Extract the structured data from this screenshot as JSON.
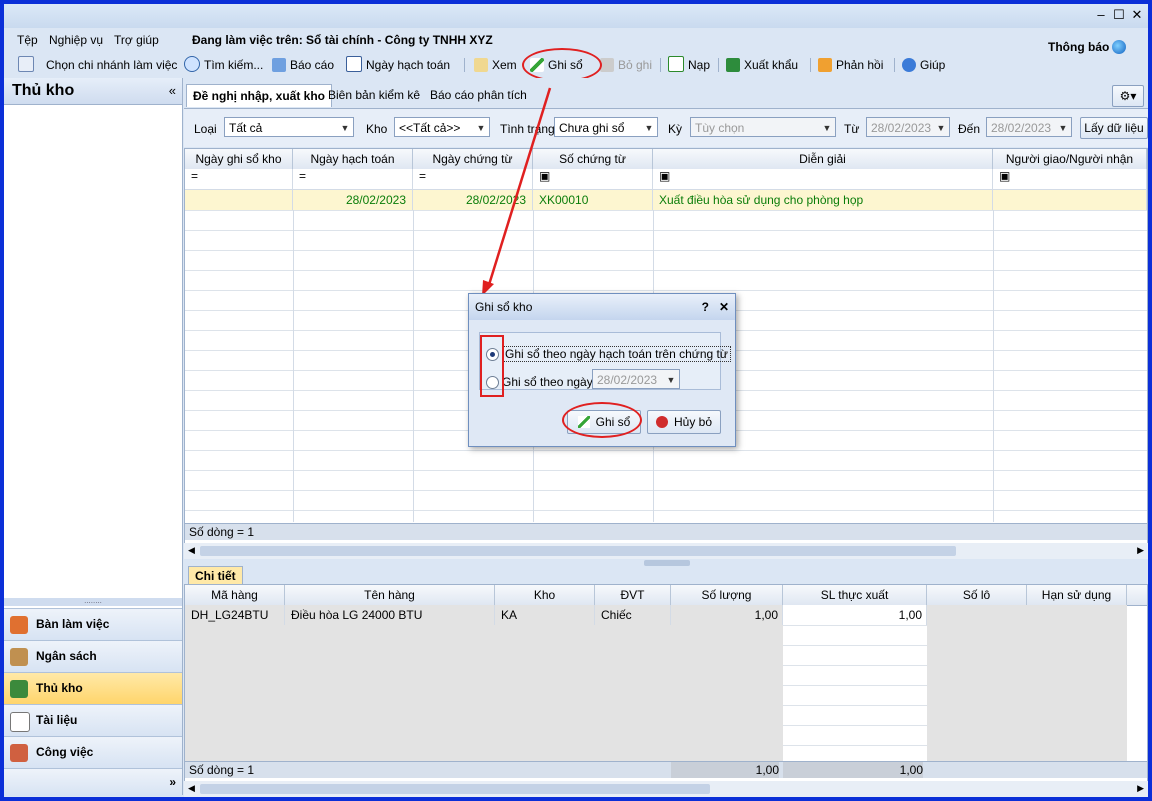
{
  "window": {
    "controls": [
      "‒",
      "☐",
      "✕"
    ]
  },
  "menu": {
    "items": [
      "Tệp",
      "Nghiệp vụ",
      "Trợ giúp"
    ],
    "working_on": "Đang làm việc trên: Sổ tài chính - Công ty TNHH XYZ",
    "notify": "Thông báo"
  },
  "toolbar": {
    "branch": "Chọn chi nhánh làm việc",
    "search": "Tìm kiếm...",
    "report": "Báo cáo",
    "posting_date": "Ngày hạch toán",
    "view": "Xem",
    "post": "Ghi sổ",
    "unpost": "Bỏ ghi",
    "load": "Nạp",
    "export": "Xuất khẩu",
    "feedback": "Phản hồi",
    "help": "Giúp"
  },
  "left": {
    "title": "Thủ kho",
    "collapse": "«",
    "grip": "........",
    "nav": [
      "Bàn làm việc",
      "Ngân sách",
      "Thủ kho",
      "Tài liệu",
      "Công việc"
    ],
    "more": "»"
  },
  "tabs": [
    "Đề nghị nhập, xuất kho",
    "Biên bản kiểm kê",
    "Báo cáo phân tích"
  ],
  "filter": {
    "type_label": "Loại",
    "type_value": "Tất cả",
    "warehouse_label": "Kho",
    "warehouse_value": "<<Tất cả>>",
    "status_label": "Tình trạng",
    "status_value": "Chưa ghi sổ",
    "period_label": "Kỳ",
    "period_value": "Tùy chọn",
    "from_label": "Từ",
    "from_value": "28/02/2023",
    "to_label": "Đến",
    "to_value": "28/02/2023",
    "fetch": "Lấy dữ liệu"
  },
  "grid": {
    "columns": [
      "Ngày ghi sổ kho",
      "Ngày hạch toán",
      "Ngày chứng từ",
      "Số chứng từ",
      "Diễn giải",
      "Người giao/Người nhận"
    ],
    "filter_row": [
      "=",
      "=",
      "=",
      "▣",
      "▣",
      "▣"
    ],
    "rows": [
      {
        "c0": "",
        "c1": "28/02/2023",
        "c2": "28/02/2023",
        "c3": "XK00010",
        "c4": "Xuất điều hòa sử dụng cho phòng họp",
        "c5": ""
      }
    ],
    "footer": "Số dòng = 1"
  },
  "detail": {
    "tab": "Chi tiết",
    "columns": [
      "Mã hàng",
      "Tên hàng",
      "Kho",
      "ĐVT",
      "Số lượng",
      "SL thực xuất",
      "Số lô",
      "Hạn sử dụng"
    ],
    "rows": [
      {
        "code": "DH_LG24BTU",
        "name": "Điều hòa LG 24000 BTU",
        "wh": "KA",
        "unit": "Chiếc",
        "qty": "1,00",
        "actual": "1,00"
      }
    ],
    "footer": "Số dòng = 1",
    "total_qty": "1,00",
    "total_actual": "1,00"
  },
  "dialog": {
    "title": "Ghi sổ kho",
    "help": "?",
    "close": "✕",
    "opt1": "Ghi sổ theo ngày hạch toán trên chứng từ",
    "opt2": "Ghi sổ theo ngày",
    "date": "28/02/2023",
    "ok": "Ghi sổ",
    "cancel": "Hủy bỏ"
  },
  "colors": {
    "accent": "#e02020",
    "highlight_row": "#fdf6d0",
    "green_text": "#0a7d0a"
  }
}
